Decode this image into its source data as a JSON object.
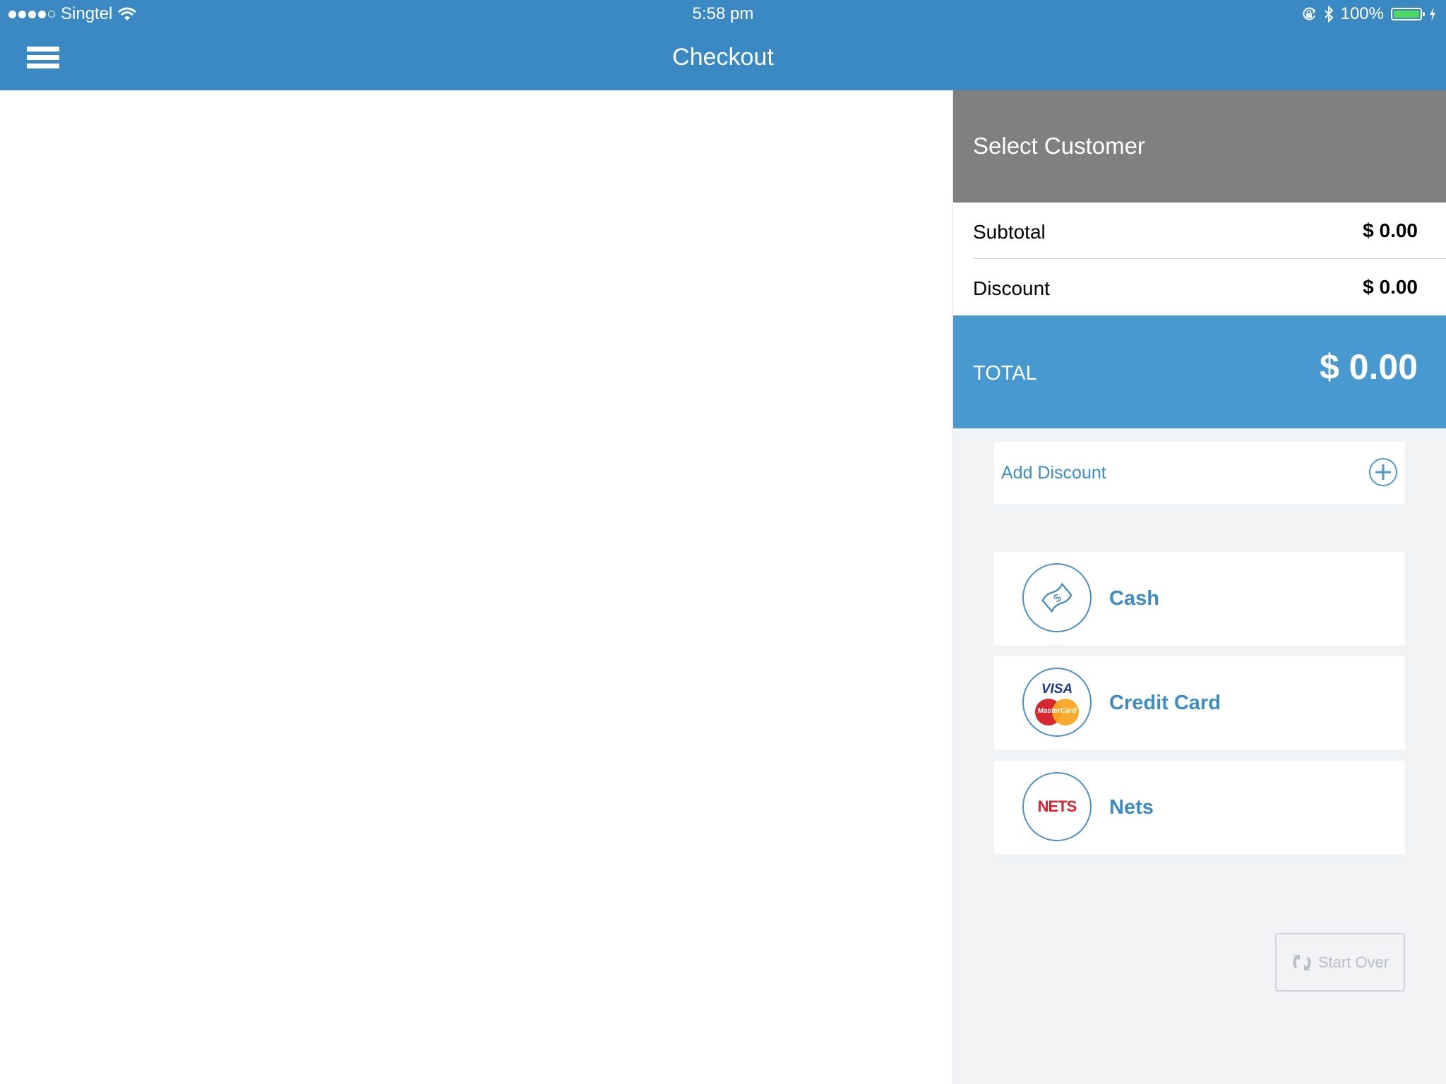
{
  "status_bar": {
    "carrier": "Singtel",
    "signal_bars_filled": 4,
    "signal_bars_total": 5,
    "time": "5:58 pm",
    "battery_percent": "100%",
    "battery_level": 1.0,
    "icons": [
      "wifi-icon",
      "rotation-lock-icon",
      "bluetooth-icon",
      "battery-icon",
      "charging-icon"
    ]
  },
  "nav": {
    "title": "Checkout",
    "menu_icon": "hamburger-menu-icon"
  },
  "summary": {
    "select_customer": "Select Customer",
    "subtotal_label": "Subtotal",
    "subtotal_value": "$ 0.00",
    "discount_label": "Discount",
    "discount_value": "$ 0.00",
    "total_label": "TOTAL",
    "total_value": "$ 0.00"
  },
  "add_discount": {
    "label": "Add Discount",
    "icon": "plus-circle-icon"
  },
  "payment_methods": [
    {
      "label": "Cash",
      "icon": "cash-icon"
    },
    {
      "label": "Credit Card",
      "icon": "visa-mastercard-icon",
      "visa_text": "VISA",
      "mastercard_text": "MasterCard"
    },
    {
      "label": "Nets",
      "icon": "nets-icon",
      "logo_text_n": "N",
      "logo_text_rest": "ETS"
    }
  ],
  "start_over": {
    "label": "Start Over",
    "icon": "refresh-icon"
  },
  "colors": {
    "brand_blue": "#3a89c2",
    "total_blue": "#4799cf",
    "link_blue": "#3d8cc4",
    "customer_gray": "#808080",
    "panel_bg": "#f2f3f5",
    "battery_green": "#4cd964"
  }
}
